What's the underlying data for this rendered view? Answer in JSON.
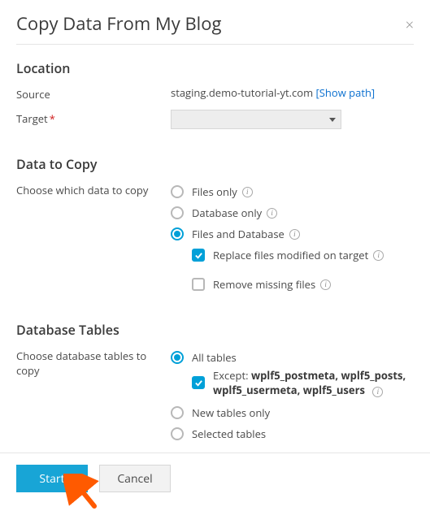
{
  "dialog": {
    "title": "Copy Data From My Blog",
    "close_glyph": "×"
  },
  "location": {
    "heading": "Location",
    "source_label": "Source",
    "source_value": "staging.demo-tutorial-yt.com",
    "show_path_link": "[Show path]",
    "target_label": "Target",
    "target_required": "*"
  },
  "data_to_copy": {
    "heading": "Data to Copy",
    "help_text": "Choose which data to copy",
    "options": {
      "files_only": "Files only",
      "database_only": "Database only",
      "files_and_db": "Files and Database",
      "replace_files": "Replace files modified on target",
      "remove_missing": "Remove missing files"
    }
  },
  "db_tables": {
    "heading": "Database Tables",
    "help_text": "Choose database tables to copy",
    "options": {
      "all_tables": "All tables",
      "except_label": "Except: ",
      "except_value": "wplf5_postmeta, wplf5_posts, wplf5_usermeta, wplf5_users",
      "new_tables": "New tables only",
      "selected_tables": "Selected tables"
    }
  },
  "buttons": {
    "start": "Start",
    "cancel": "Cancel"
  },
  "info_glyph": "i"
}
